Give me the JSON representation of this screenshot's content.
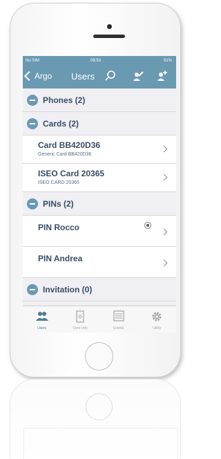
{
  "status": {
    "carrier": "No SIM",
    "time": "08:53",
    "battery": "91%"
  },
  "nav": {
    "back_label": "Argo",
    "title": "Users"
  },
  "sections": [
    {
      "title": "Phones (2)"
    },
    {
      "title": "Cards (2)"
    },
    {
      "title": "PINs (2)"
    },
    {
      "title": "Invitation (0)"
    }
  ],
  "cards": [
    {
      "title": "Card BB420D36",
      "subtitle": "Generic Card BB420D36"
    },
    {
      "title": "ISEO Card 20365",
      "subtitle": "ISEO CARD 20365"
    }
  ],
  "pins": [
    {
      "title": "PIN Rocco"
    },
    {
      "title": "PIN Andrea"
    }
  ],
  "tabs": [
    {
      "label": "Users",
      "icon": "users-icon"
    },
    {
      "label": "Door Info",
      "icon": "door-info-icon"
    },
    {
      "label": "Events",
      "icon": "events-icon"
    },
    {
      "label": "Utility",
      "icon": "gear-icon"
    }
  ],
  "colors": {
    "accent": "#6a99b2",
    "text": "#3a4d66"
  }
}
